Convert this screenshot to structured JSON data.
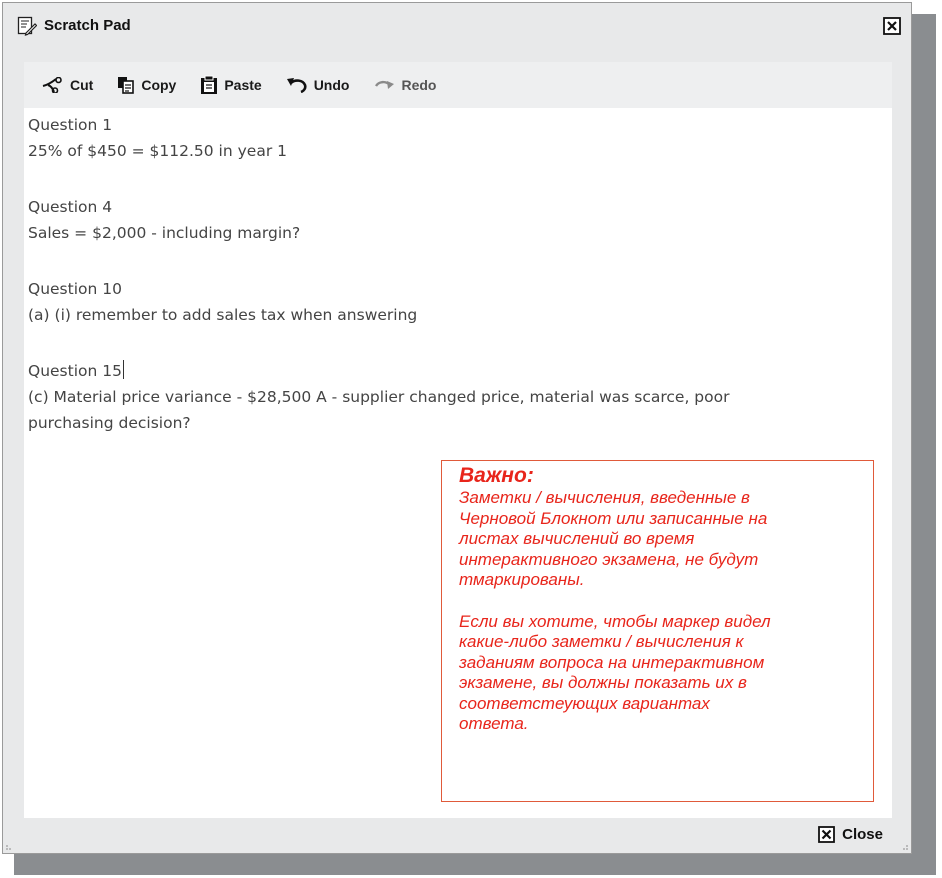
{
  "window": {
    "title": "Scratch Pad"
  },
  "toolbar": {
    "cut": "Cut",
    "copy": "Copy",
    "paste": "Paste",
    "undo": "Undo",
    "redo": "Redo"
  },
  "editor": {
    "lines": [
      "Question 1",
      "25% of $450 = $112.50 in year 1",
      "Question 4",
      "Sales = $2,000 - including margin?",
      "Question 10",
      "(a) (i) remember to add sales tax when answering",
      "Question 15",
      "(c) Material price variance  - $28,500 A - supplier changed price, material was scarce, poor",
      "purchasing decision?"
    ]
  },
  "note": {
    "heading": "Важно:",
    "para1": [
      "Заметки / вычисления, введенные в",
      "Черновой Блокнот или записанные на",
      "листах вычислений во время",
      "интерактивного экзамена, не будут",
      "тмаркированы."
    ],
    "para2": [
      "Если вы хотите, чтобы маркер видел",
      "какие-либо заметки / вычисления к",
      "заданиям вопроса на интерактивном",
      "экзамене, вы должны показать их в",
      "соответстеующих вариантах",
      "ответа."
    ],
    "color": "#e8251b"
  },
  "footer": {
    "close_label": "Close"
  },
  "icons": {
    "title": "scratchpad-icon",
    "title_close": "close-box-icon",
    "cut": "scissors-icon",
    "copy": "copy-icon",
    "paste": "clipboard-icon",
    "undo": "undo-arrow-icon",
    "redo": "redo-arrow-icon",
    "footer_close": "close-box-icon"
  }
}
